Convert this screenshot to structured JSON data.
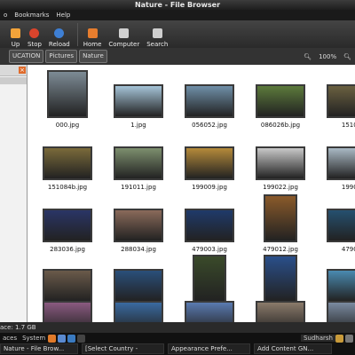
{
  "window": {
    "title": "Nature - File Browser"
  },
  "menubar": {
    "items": [
      "o",
      "Bookmarks",
      "Help"
    ]
  },
  "toolbar": {
    "buttons": [
      {
        "label": "Up",
        "icon": "up-arrow-icon",
        "color": "#f2a33a"
      },
      {
        "label": "Stop",
        "icon": "stop-icon",
        "color": "#d9442c"
      },
      {
        "label": "Reload",
        "icon": "reload-icon",
        "color": "#3e7fd4"
      },
      {
        "label": "Home",
        "icon": "home-icon",
        "color": "#e67d2e"
      },
      {
        "label": "Computer",
        "icon": "computer-icon",
        "color": "#d0d0d0"
      },
      {
        "label": "Search",
        "icon": "search-icon",
        "color": "#cfcfcf"
      }
    ]
  },
  "location": {
    "crumbs": [
      "UCATION",
      "Pictures",
      "Nature"
    ],
    "zoom": "100%"
  },
  "files": [
    {
      "name": "000.jpg",
      "color": "#7d8b95"
    },
    {
      "name": "1.jpg",
      "color": "#a5c4d8"
    },
    {
      "name": "056052.jpg",
      "color": "#6f8fa8"
    },
    {
      "name": "086026b.jpg",
      "color": "#5c7a3b"
    },
    {
      "name": "15108",
      "color": "#6a6040"
    },
    {
      "name": "151084b.jpg",
      "color": "#7a6a3a"
    },
    {
      "name": "191011.jpg",
      "color": "#7d8f6e"
    },
    {
      "name": "199009.jpg",
      "color": "#b58a3a"
    },
    {
      "name": "199022.jpg",
      "color": "#c8c8c8"
    },
    {
      "name": "19902",
      "color": "#a9b9c4"
    },
    {
      "name": "283036.jpg",
      "color": "#2a3566"
    },
    {
      "name": "288034.jpg",
      "color": "#8a6a5a"
    },
    {
      "name": "479003.jpg",
      "color": "#1f3a6a"
    },
    {
      "name": "479012.jpg",
      "color": "#8a5a2a"
    },
    {
      "name": "47901",
      "color": "#25506f"
    },
    {
      "name": "479035.jpg",
      "color": "#6a5a4a"
    },
    {
      "name": "479038.jpg",
      "color": "#2a4f7a"
    },
    {
      "name": "479043.jpg",
      "color": "#3a4a2a"
    },
    {
      "name": "479054.jpg",
      "color": "#2a4f8a"
    },
    {
      "name": "47905",
      "color": "#4a8ab0"
    },
    {
      "name": "",
      "color": "#8a5a80"
    },
    {
      "name": "",
      "color": "#3a6aa0"
    },
    {
      "name": "",
      "color": "#5a7ab0"
    },
    {
      "name": "",
      "color": "#8a7a6a"
    },
    {
      "name": "",
      "color": "#7a8aa0"
    }
  ],
  "status": {
    "text": "ace: 1.7 GB"
  },
  "taskbar": {
    "menus": [
      "aces",
      "System"
    ],
    "user": "Sudharsh",
    "tasks": [
      "Nature - File Brow...",
      "[Select Country -",
      "Appearance Prefe...",
      "Add Content GN..."
    ]
  }
}
